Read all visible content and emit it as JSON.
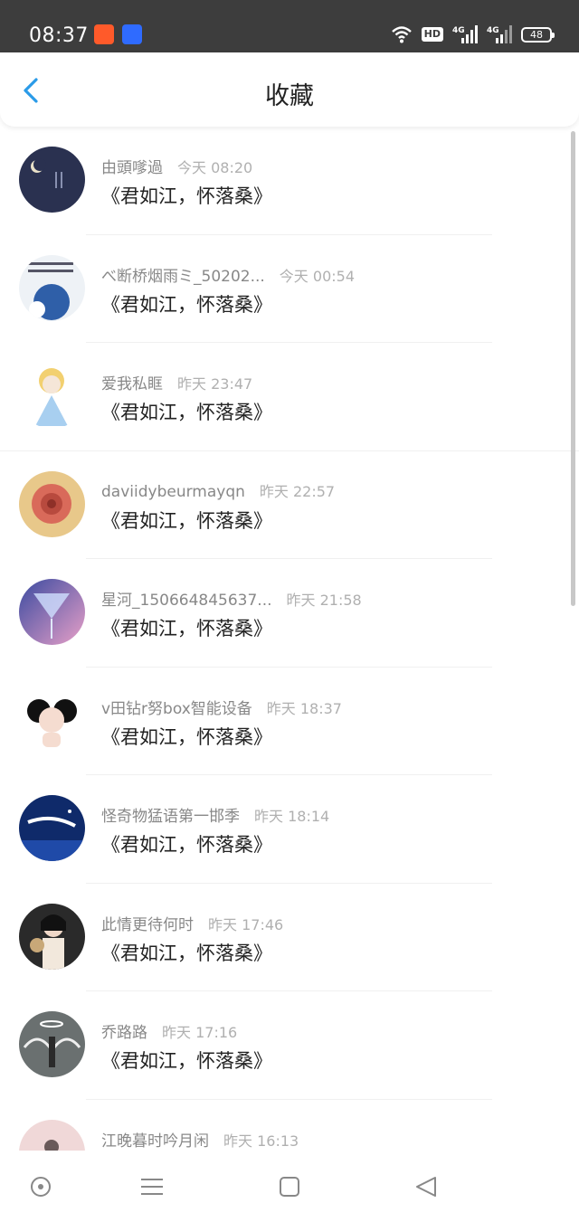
{
  "status_bar": {
    "time": "08:37",
    "hd_label": "HD",
    "network_label": "4G",
    "battery": "48"
  },
  "header": {
    "title": "收藏",
    "back_icon": "chevron-left-icon",
    "accent_color": "#2a9be8"
  },
  "items": [
    {
      "name": "由頭嗲過",
      "time": "今天 08:20",
      "message": "《君如江，怀落桑》"
    },
    {
      "name": "べ断桥烟雨ミ_50202...",
      "time": "今天 00:54",
      "message": "《君如江，怀落桑》"
    },
    {
      "name": "爱我私眶",
      "time": "昨天 23:47",
      "message": "《君如江，怀落桑》"
    },
    {
      "name": "daviidybeurmayqn",
      "time": "昨天 22:57",
      "message": "《君如江，怀落桑》"
    },
    {
      "name": "星河_150664845637...",
      "time": "昨天 21:58",
      "message": "《君如江，怀落桑》"
    },
    {
      "name": "v田钻r努box智能设备",
      "time": "昨天 18:37",
      "message": "《君如江，怀落桑》"
    },
    {
      "name": "怪奇物猛语第一邯季",
      "time": "昨天 18:14",
      "message": "《君如江，怀落桑》"
    },
    {
      "name": "此情更待何时",
      "time": "昨天 17:46",
      "message": "《君如江，怀落桑》"
    },
    {
      "name": "乔路路",
      "time": "昨天 17:16",
      "message": "《君如江，怀落桑》"
    },
    {
      "name": "江晚暮时吟月闲",
      "time": "昨天 16:13",
      "message": ""
    }
  ],
  "nav_bar": {
    "buttons": [
      "assistant-icon",
      "menu-icon",
      "home-square-icon",
      "back-triangle-icon"
    ]
  }
}
